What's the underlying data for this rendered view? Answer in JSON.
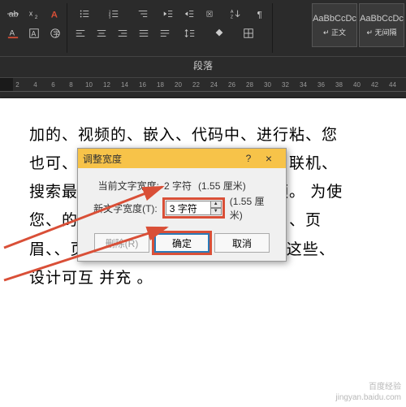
{
  "section_label": "段落",
  "styles": [
    {
      "preview": "AaBbCcDc",
      "label": "↵ 正文"
    },
    {
      "preview": "AaBbCcDc",
      "label": "↵ 无间隔"
    }
  ],
  "ruler_ticks": [
    "2",
    "4",
    "6",
    "8",
    "10",
    "12",
    "14",
    "16",
    "18",
    "20",
    "22",
    "24",
    "26",
    "28",
    "30",
    "32",
    "34",
    "36",
    "38",
    "40",
    "42",
    "44"
  ],
  "doc_lines": [
    "加的、视频的、嵌入、代码中、进行粘、您",
    "也可、以键、入一个、关键、字以、联机、",
    "搜索最、适合、您的、文档的、视频。  为使",
    "您、的文、档具有专、业外、观供了、页",
    "眉、、页脚、封面、和文、本框设计  这些、",
    "设计可互                并充                。"
  ],
  "dialog": {
    "title": "调整宽度",
    "help": "?",
    "close": "×",
    "row1_label": "当前文字宽度:",
    "row1_value": "2 字符",
    "row1_cm": "(1.55 厘米)",
    "row2_label": "新文字宽度(T):",
    "row2_value": "3 字符",
    "row2_cm": "(1.55 厘米)",
    "btn_delete": "删除(R)",
    "btn_ok": "确定",
    "btn_cancel": "取消"
  },
  "watermark": {
    "l1": "百度经验",
    "l2": "jingyan.baidu.com"
  }
}
